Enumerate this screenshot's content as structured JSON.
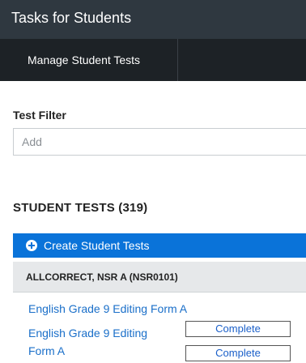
{
  "header": {
    "title": "Tasks for Students"
  },
  "subnav": {
    "tab_label": "Manage Student Tests"
  },
  "filter": {
    "label": "Test Filter",
    "placeholder": "Add"
  },
  "section": {
    "title": "STUDENT TESTS (319)"
  },
  "create": {
    "label": "Create Student Tests"
  },
  "student": {
    "name": "ALLCORRECT, NSR A (NSR0101)"
  },
  "tests": [
    {
      "name": "English Grade 9 Editing Form A",
      "status": ""
    },
    {
      "name_line1": "English Grade 9 Editing",
      "name_line2": "Form A",
      "status1": "Complete",
      "status2": "Complete"
    }
  ],
  "colors": {
    "topbar": "#2f3840",
    "subnav": "#1d2226",
    "accent": "#0a73d9",
    "link": "#1a6fc9"
  }
}
